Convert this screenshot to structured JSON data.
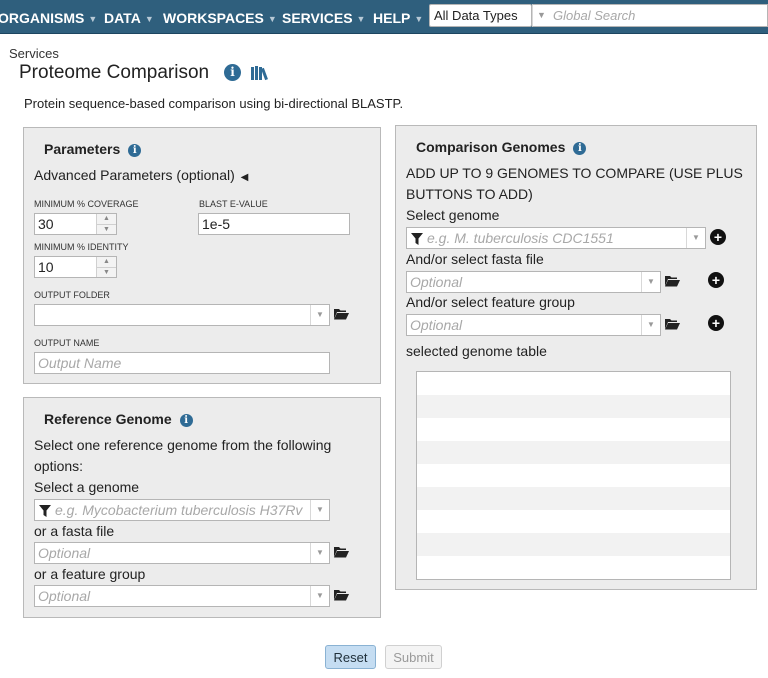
{
  "nav": {
    "items": [
      {
        "label": "ORGANISMS"
      },
      {
        "label": "DATA"
      },
      {
        "label": "WORKSPACES"
      },
      {
        "label": "SERVICES"
      },
      {
        "label": "HELP"
      }
    ],
    "datatype_value": "All Data Types",
    "search_placeholder": "Global Search"
  },
  "header": {
    "breadcrumb": "Services",
    "title": "Proteome Comparison",
    "description": "Protein sequence-based comparison using bi-directional BLASTP."
  },
  "parameters": {
    "title": "Parameters",
    "advanced_label": "Advanced Parameters (optional)",
    "min_coverage_label": "MINIMUM % COVERAGE",
    "min_coverage_value": "30",
    "blast_evalue_label": "BLAST E-VALUE",
    "blast_evalue_value": "1e-5",
    "min_identity_label": "MINIMUM % IDENTITY",
    "min_identity_value": "10",
    "output_folder_label": "OUTPUT FOLDER",
    "output_folder_value": "",
    "output_name_label": "OUTPUT NAME",
    "output_name_placeholder": "Output Name"
  },
  "reference": {
    "title": "Reference Genome",
    "instructions": "Select one reference genome from the following options:",
    "select_genome_label": "Select a genome",
    "select_genome_placeholder": "e.g. Mycobacterium tuberculosis H37Rv",
    "fasta_label": "or a fasta file",
    "fasta_placeholder": "Optional",
    "feature_group_label": "or a feature group",
    "feature_group_placeholder": "Optional"
  },
  "comparison": {
    "title": "Comparison Genomes",
    "instructions": "ADD UP TO 9 GENOMES TO COMPARE (USE PLUS BUTTONS TO ADD)",
    "select_genome_label": "Select genome",
    "select_genome_placeholder": "e.g. M. tuberculosis CDC1551",
    "fasta_label": "And/or select fasta file",
    "fasta_placeholder": "Optional",
    "feature_group_label": "And/or select feature group",
    "feature_group_placeholder": "Optional",
    "table_label": "selected genome table"
  },
  "buttons": {
    "reset": "Reset",
    "submit": "Submit"
  },
  "icons": [
    "info-icon",
    "library-icon",
    "caret-left-icon",
    "filter-icon",
    "folder-open-icon",
    "plus-circle-icon",
    "chevron-down-icon"
  ]
}
